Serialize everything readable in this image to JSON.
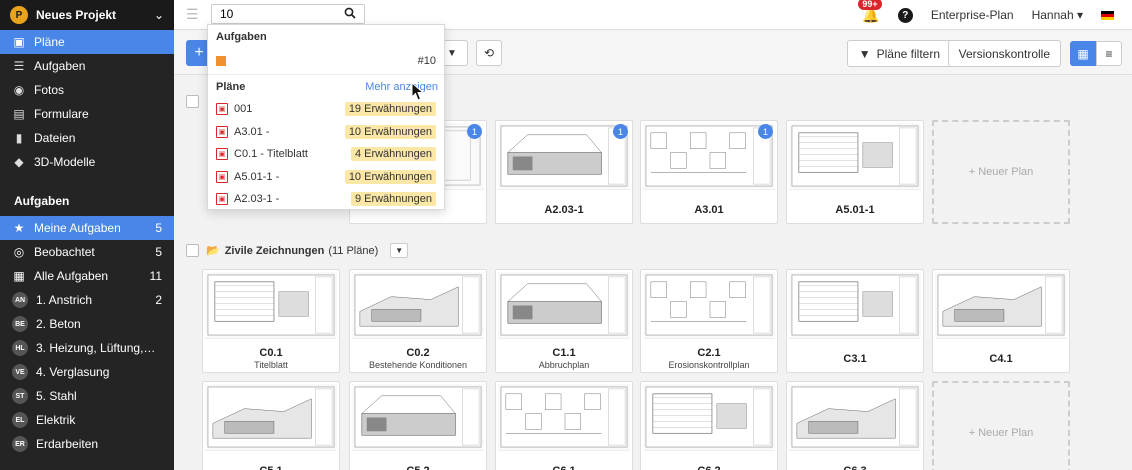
{
  "project": {
    "name": "Neues Projekt"
  },
  "nav": [
    {
      "label": "Pläne",
      "icon": "image-icon",
      "active": true
    },
    {
      "label": "Aufgaben",
      "icon": "list-icon",
      "active": false
    },
    {
      "label": "Fotos",
      "icon": "camera-icon",
      "active": false
    },
    {
      "label": "Formulare",
      "icon": "clipboard-icon",
      "active": false
    },
    {
      "label": "Dateien",
      "icon": "file-icon",
      "active": false
    },
    {
      "label": "3D-Modelle",
      "icon": "cube-icon",
      "active": false
    }
  ],
  "tasks_section": {
    "title": "Aufgaben",
    "items": [
      {
        "label": "Meine Aufgaben",
        "count": "5",
        "icon": "star-icon",
        "active": true
      },
      {
        "label": "Beobachtet",
        "count": "5",
        "icon": "eye-icon"
      },
      {
        "label": "Alle Aufgaben",
        "count": "11",
        "icon": "grid-icon"
      },
      {
        "abbr": "AN",
        "label": "1. Anstrich",
        "count": "2"
      },
      {
        "abbr": "BE",
        "label": "2. Beton",
        "count": ""
      },
      {
        "abbr": "HL",
        "label": "3. Heizung, Lüftung, K...",
        "count": ""
      },
      {
        "abbr": "VE",
        "label": "4. Verglasung",
        "count": ""
      },
      {
        "abbr": "ST",
        "label": "5. Stahl",
        "count": ""
      },
      {
        "abbr": "EL",
        "label": "Elektrik",
        "count": ""
      },
      {
        "abbr": "ER",
        "label": "Erdarbeiten",
        "count": ""
      }
    ]
  },
  "search": {
    "value": "10"
  },
  "topbar": {
    "notif_count": "99+",
    "help": "?",
    "plan": "Enterprise-Plan",
    "user": "Hannah"
  },
  "toolbar": {
    "add": "+",
    "filter": "Pläne filtern",
    "version": "Versionskontrolle"
  },
  "dropdown": {
    "tasks_title": "Aufgaben",
    "task_number": "#10",
    "plans_title": "Pläne",
    "more": "Mehr anzeigen",
    "plans": [
      {
        "name": "001",
        "mentions": "19 Erwähnungen"
      },
      {
        "name": "A3.01 -",
        "mentions": "10 Erwähnungen"
      },
      {
        "name": "C0.1 - Titelblatt",
        "mentions": "4 Erwähnungen"
      },
      {
        "name": "A5.01-1 -",
        "mentions": "10 Erwähnungen"
      },
      {
        "name": "A2.03-1 -",
        "mentions": "9 Erwähnungen"
      }
    ]
  },
  "groups": [
    {
      "name": "",
      "count": ""
    },
    {
      "name": "Zivile Zeichnungen",
      "count": "(11 Pläne)"
    }
  ],
  "new_plan": "+ Neuer Plan",
  "row1": [
    {
      "name": "A2.03-1",
      "badge": "1"
    },
    {
      "name": "A3.01",
      "badge": "1"
    },
    {
      "name": "A5.01-1",
      "badge": ""
    }
  ],
  "row1_partial_badge": "1",
  "row2": [
    {
      "name": "C0.1",
      "sub": "Titelblatt"
    },
    {
      "name": "C0.2",
      "sub": "Bestehende Konditionen"
    },
    {
      "name": "C1.1",
      "sub": "Abbruchplan"
    },
    {
      "name": "C2.1",
      "sub": "Erosionskontrollplan"
    },
    {
      "name": "C3.1",
      "sub": ""
    },
    {
      "name": "C4.1",
      "sub": ""
    }
  ],
  "row3": [
    {
      "name": "C5.1"
    },
    {
      "name": "C5.2"
    },
    {
      "name": "C6.1"
    },
    {
      "name": "C6.2"
    },
    {
      "name": "C6.3"
    }
  ]
}
